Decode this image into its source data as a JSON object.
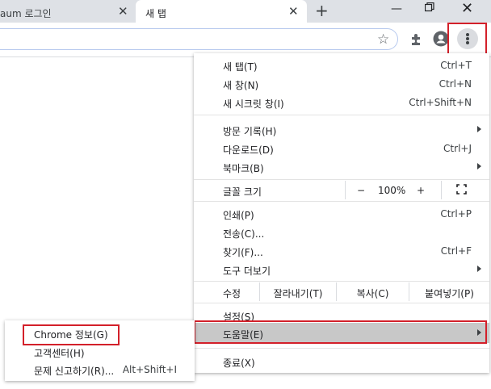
{
  "tabs": [
    {
      "title": "aum 로그인"
    },
    {
      "title": "새 탭"
    }
  ],
  "window": {
    "min_icon": "minimize-icon",
    "max_icon": "restore-icon",
    "close_icon": "close-icon"
  },
  "toolbar": {
    "bookmark_icon": "star-icon",
    "extensions_icon": "puzzle-icon",
    "profile_icon": "profile-icon",
    "menu_icon": "kebab-menu-icon"
  },
  "menu": {
    "new_tab": {
      "label": "새 탭(T)",
      "shortcut": "Ctrl+T"
    },
    "new_window": {
      "label": "새 창(N)",
      "shortcut": "Ctrl+N"
    },
    "incognito": {
      "label": "새 시크릿 창(I)",
      "shortcut": "Ctrl+Shift+N"
    },
    "history": {
      "label": "방문 기록(H)"
    },
    "downloads": {
      "label": "다운로드(D)",
      "shortcut": "Ctrl+J"
    },
    "bookmarks": {
      "label": "북마크(B)"
    },
    "zoom": {
      "label": "글꼴 크기",
      "minus": "−",
      "value": "100%",
      "plus": "+"
    },
    "print": {
      "label": "인쇄(P)",
      "shortcut": "Ctrl+P"
    },
    "cast": {
      "label": "전송(C)..."
    },
    "find": {
      "label": "찾기(F)...",
      "shortcut": "Ctrl+F"
    },
    "more_tools": {
      "label": "도구 더보기"
    },
    "edit": {
      "label": "수정",
      "cut": "잘라내기(T)",
      "copy": "복사(C)",
      "paste": "붙여넣기(P)"
    },
    "settings": {
      "label": "설정(S)"
    },
    "help": {
      "label": "도움말(E)"
    },
    "exit": {
      "label": "종료(X)"
    }
  },
  "submenu": {
    "about": {
      "label": "Chrome 정보(G)"
    },
    "help_center": {
      "label": "고객센터(H)"
    },
    "report": {
      "label": "문제 신고하기(R)...",
      "shortcut": "Alt+Shift+I"
    }
  },
  "colors": {
    "highlight_border": "#d3202a",
    "hover_bg": "#c8c8c8"
  }
}
